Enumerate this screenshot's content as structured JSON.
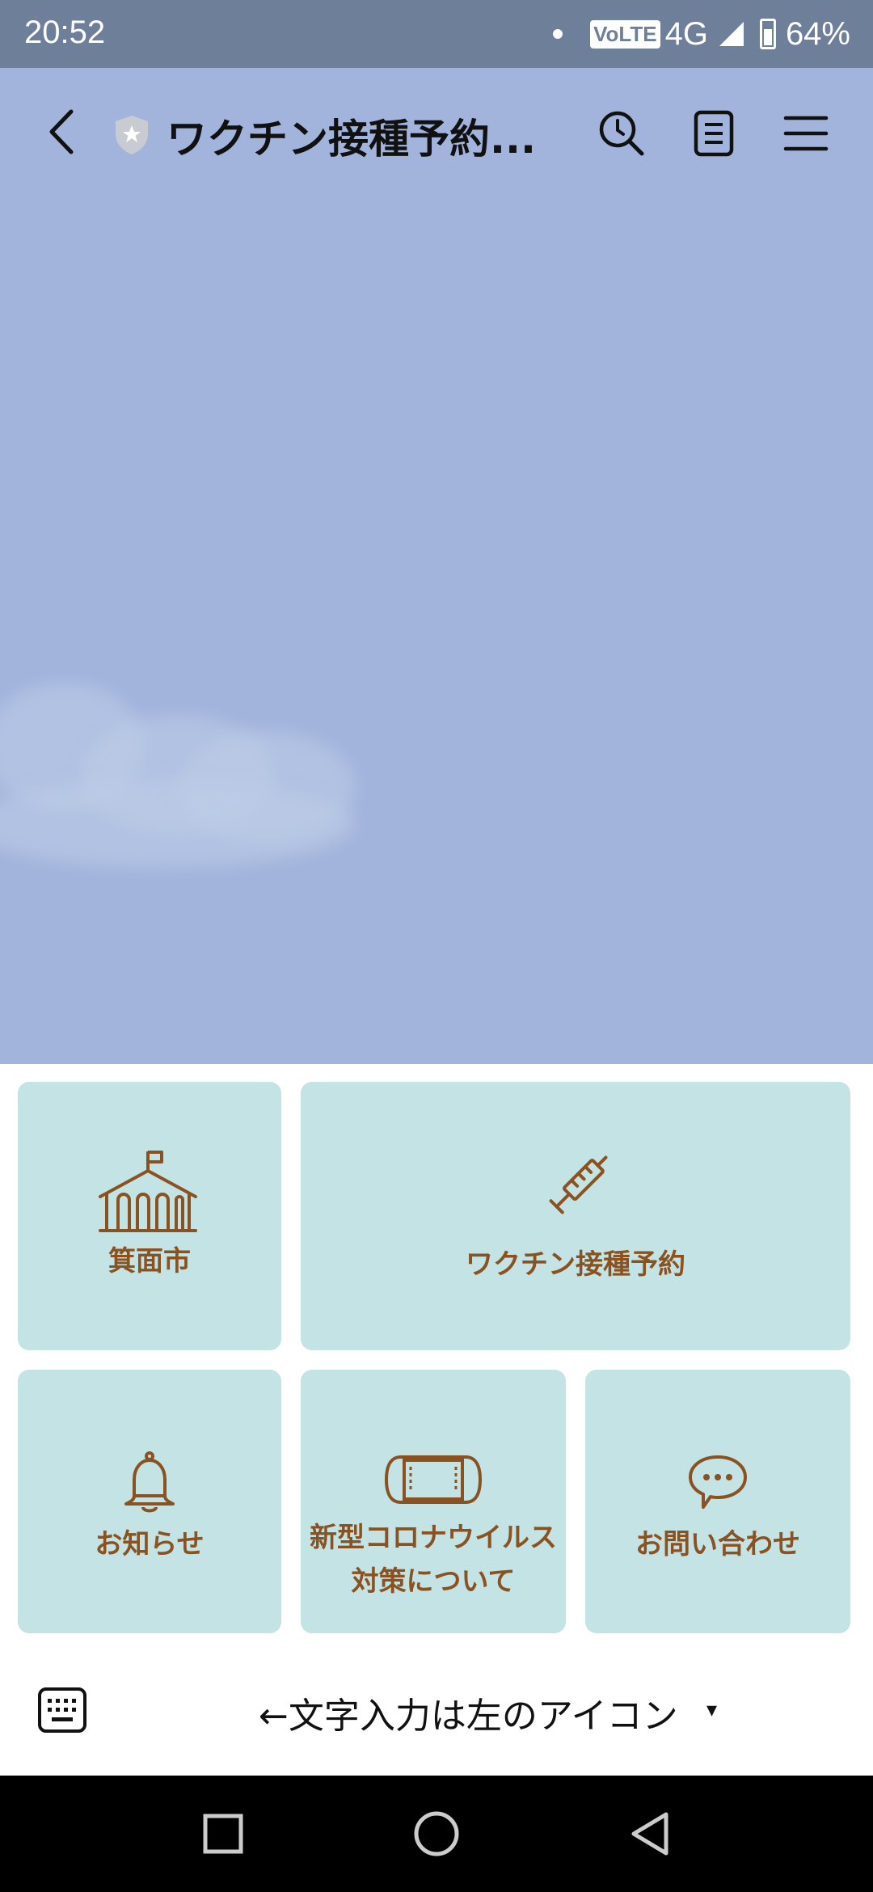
{
  "status_bar": {
    "time": "20:52",
    "volte": "VoLTE",
    "network": "4G",
    "battery": "64%"
  },
  "header": {
    "title": "ワクチン接種予約...",
    "icons": [
      "back-chevron-icon",
      "shield-star-icon",
      "search-clock-icon",
      "notes-icon",
      "hamburger-menu-icon"
    ]
  },
  "rich_menu": {
    "tiles": [
      {
        "label": "箕面市",
        "icon": "school-building-icon"
      },
      {
        "label": "ワクチン接種予約",
        "icon": "syringe-icon"
      },
      {
        "label": "お知らせ",
        "icon": "bell-icon"
      },
      {
        "label": "新型コロナウイルス",
        "label2": "対策について",
        "icon": "mask-icon"
      },
      {
        "label": "お問い合わせ",
        "icon": "speech-bubble-icon"
      }
    ],
    "accent_color": "#8a5220",
    "tile_color": "#c4e3e4"
  },
  "input_row": {
    "menu_toggle_label": "←文字入力は左のアイコン",
    "caret": "▾"
  },
  "colors": {
    "chat_background": "#a2b4dc",
    "status_bar": "#6e7f9a"
  }
}
